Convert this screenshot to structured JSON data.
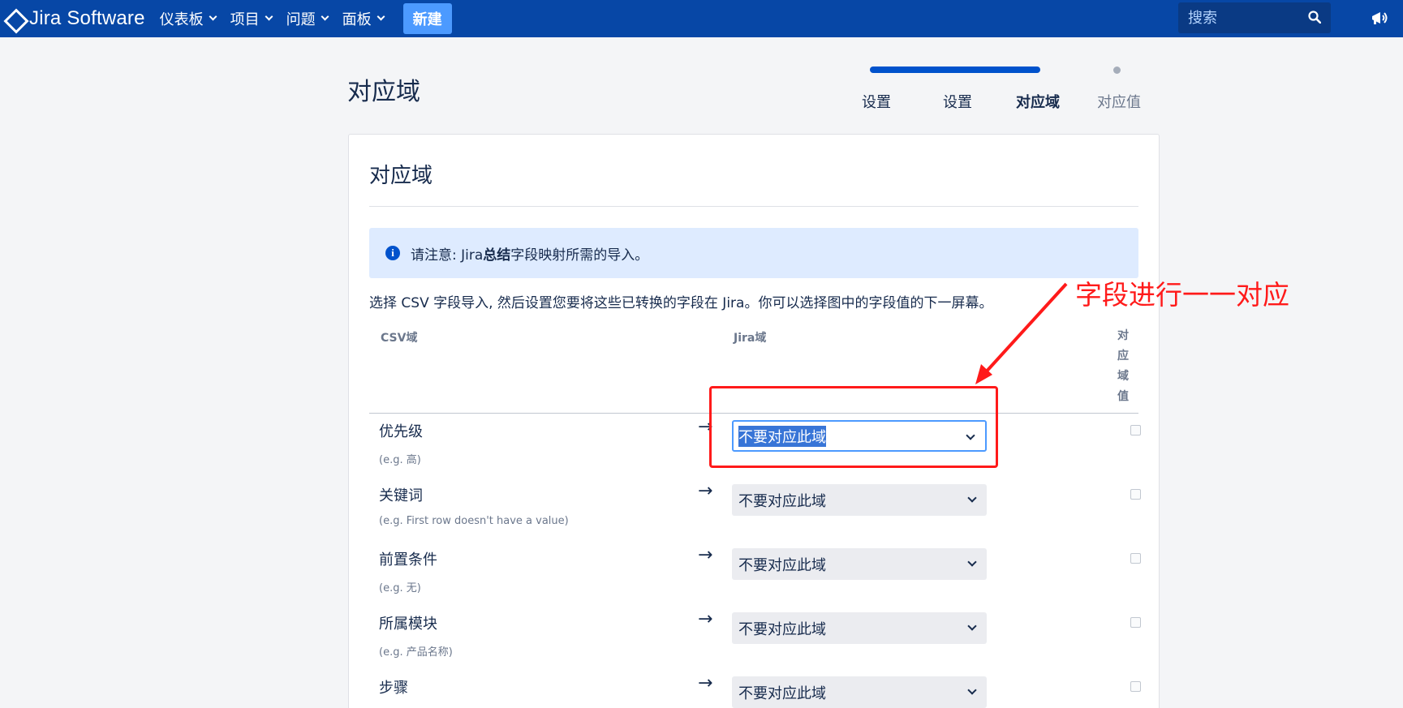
{
  "nav": {
    "logo_text": "Jira Software",
    "items": [
      {
        "label": "仪表板"
      },
      {
        "label": "项目"
      },
      {
        "label": "问题"
      },
      {
        "label": "面板"
      }
    ],
    "create_label": "新建",
    "search_placeholder": "搜索"
  },
  "page": {
    "title": "对应域",
    "steps": [
      {
        "label": "设置",
        "state": "done"
      },
      {
        "label": "设置",
        "state": "done"
      },
      {
        "label": "对应域",
        "state": "current"
      },
      {
        "label": "对应值",
        "state": "future"
      }
    ]
  },
  "card": {
    "title": "对应域",
    "info_prefix": "请注意: Jira",
    "info_bold": "总结",
    "info_suffix": "字段映射所需的导入。",
    "description": "选择 CSV 字段导入, 然后设置您要将这些已转换的字段在 Jira。你可以选择图中的字段值的下一屏幕。",
    "headers": {
      "csv": "CSV域",
      "jira": "Jira域",
      "map_values": "对应域值"
    },
    "rows": [
      {
        "field": "优先级",
        "example": "(e.g. 高)",
        "arrow": "→",
        "selected": "不要对应此域"
      },
      {
        "field": "关键词",
        "example": "(e.g. First row doesn't have a value)",
        "arrow": "→",
        "selected": "不要对应此域"
      },
      {
        "field": "前置条件",
        "example": "(e.g. 无)",
        "arrow": "→",
        "selected": "不要对应此域"
      },
      {
        "field": "所属模块",
        "example": "(e.g. 产品名称)",
        "arrow": "→",
        "selected": "不要对应此域"
      },
      {
        "field": "步骤",
        "example": "",
        "arrow": "→",
        "selected": "不要对应此域"
      }
    ]
  },
  "annotation": {
    "label": "字段进行一一对应",
    "color": "#ff1a1a"
  },
  "colors": {
    "nav_bg": "#0747a6",
    "accent": "#0052cc",
    "create_btn": "#4c9aff"
  }
}
